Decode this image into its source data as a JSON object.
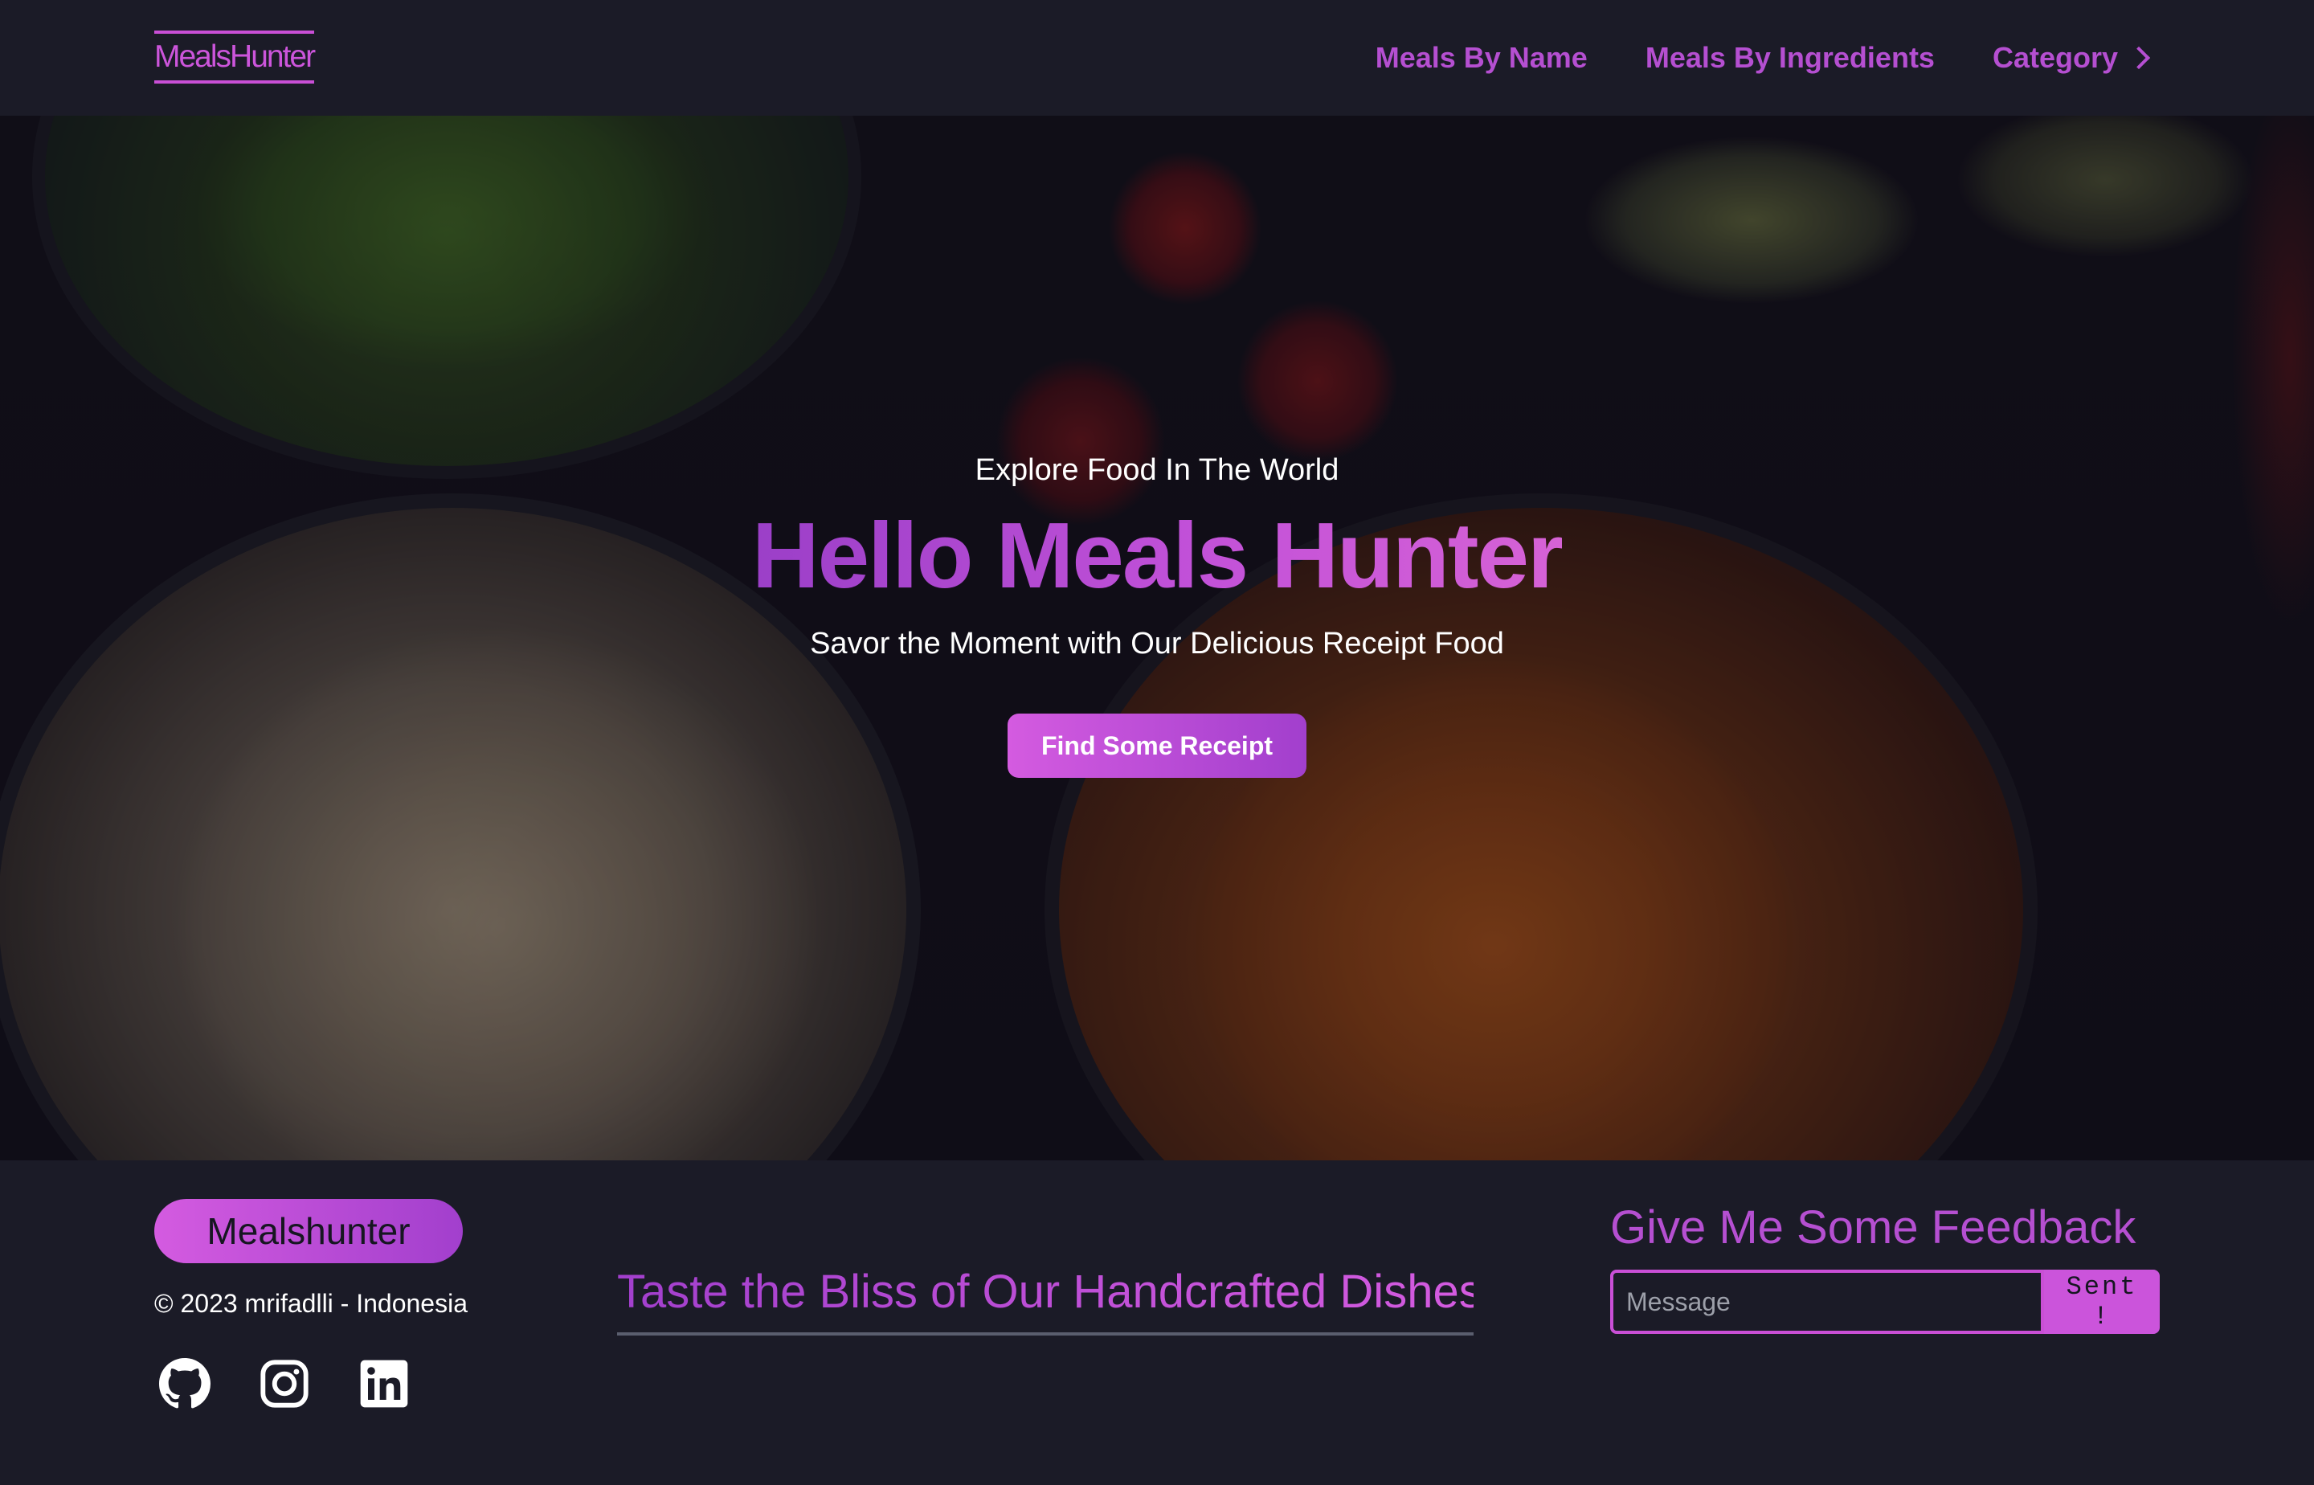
{
  "navbar": {
    "brand": "MealsHunter",
    "links": [
      {
        "label": "Meals By Name"
      },
      {
        "label": "Meals By Ingredients"
      },
      {
        "label": "Category"
      }
    ]
  },
  "hero": {
    "subtitle": "Explore Food In The World",
    "title": "Hello Meals Hunter",
    "tagline": "Savor the Moment with Our Delicious Receipt Food",
    "button_label": "Find Some Receipt"
  },
  "footer": {
    "brand": "Mealshunter",
    "copyright": "© 2023 mrifadlli - Indonesia",
    "social_icons": [
      "github-icon",
      "instagram-icon",
      "linkedin-icon"
    ],
    "tagline": "Taste the Bliss of Our Handcrafted Dishes",
    "feedback": {
      "title": "Give Me Some Feedback",
      "placeholder": "Message",
      "button_label": "Sent !"
    }
  },
  "colors": {
    "accent": "#c94fd6",
    "background": "#1b1b27",
    "gradient_start": "#d45be0",
    "gradient_end": "#a23fcd"
  }
}
